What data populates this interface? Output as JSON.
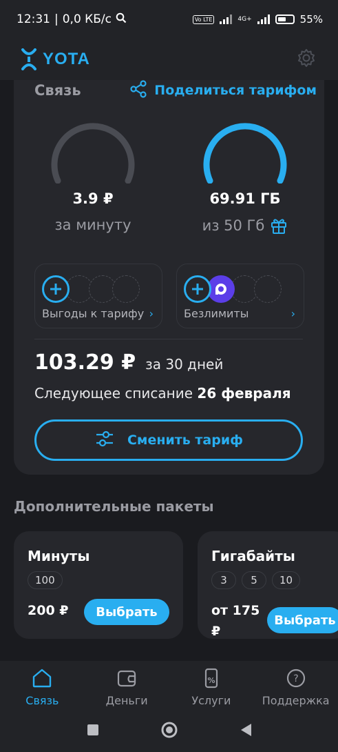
{
  "status_bar": {
    "time": "12:31",
    "speed": "0,0 КБ/с",
    "network": "4G+",
    "volte": "Vo LTE",
    "battery": "55%"
  },
  "app_bar": {
    "logo": "YOTA",
    "settings_icon": "gear-icon"
  },
  "connection": {
    "title": "Связь",
    "share_label": "Поделиться тарифом",
    "minutes_gauge": {
      "value": "3.9 ₽",
      "caption": "за минуту",
      "fill": 0
    },
    "data_gauge": {
      "value": "69.91 ГБ",
      "caption": "из 50 Гб",
      "fill": 1
    },
    "benefits_tile": {
      "label": "Выгоды к тарифу"
    },
    "unlimited_tile": {
      "label": "Безлимиты"
    },
    "price": "103.29 ₽",
    "period": "за 30 дней",
    "next_charge_label": "Следующее списание",
    "next_charge_date": "26 февраля",
    "change_button": "Сменить тариф"
  },
  "packages": {
    "title": "Дополнительные пакеты",
    "items": [
      {
        "title": "Минуты",
        "chips": [
          "100"
        ],
        "price": "200 ₽",
        "button": "Выбрать"
      },
      {
        "title": "Гигабайты",
        "chips": [
          "3",
          "5",
          "10"
        ],
        "price_line1": "от 175",
        "price_line2": "₽",
        "button": "Выбрать"
      }
    ]
  },
  "bottom_nav": [
    {
      "label": "Связь",
      "icon": "home-icon",
      "active": true
    },
    {
      "label": "Деньги",
      "icon": "wallet-icon",
      "active": false
    },
    {
      "label": "Услуги",
      "icon": "phone-percent-icon",
      "active": false
    },
    {
      "label": "Поддержка",
      "icon": "help-icon",
      "active": false
    }
  ],
  "colors": {
    "accent": "#29aef0",
    "background": "#1a1b1f",
    "card": "#26272c"
  }
}
